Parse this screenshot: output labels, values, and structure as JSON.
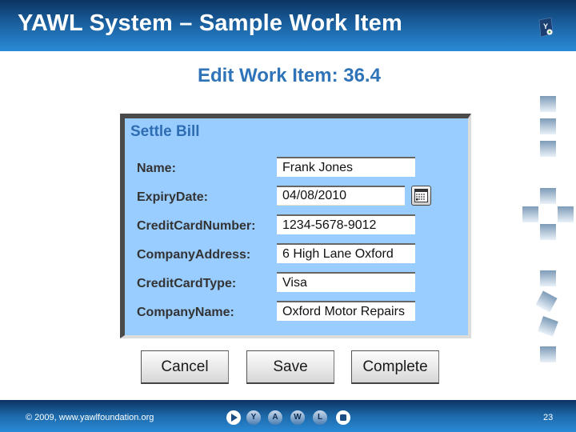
{
  "header": {
    "title": "YAWL System – Sample Work Item",
    "logo_icon": "yawl-logo-icon"
  },
  "work_item": {
    "title": "Edit Work Item: 36.4"
  },
  "form": {
    "title": "Settle Bill",
    "fields": [
      {
        "label": "Name:",
        "value": "Frank Jones"
      },
      {
        "label": "ExpiryDate:",
        "value": "04/08/2010"
      },
      {
        "label": "CreditCardNumber:",
        "value": "1234-5678-9012"
      },
      {
        "label": "CompanyAddress:",
        "value": "6 High Lane Oxford"
      },
      {
        "label": "CreditCardType:",
        "value": "Visa"
      },
      {
        "label": "CompanyName:",
        "value": "Oxford Motor Repairs"
      }
    ],
    "calendar_icon": "calendar-icon"
  },
  "buttons": {
    "cancel": "Cancel",
    "save": "Save",
    "complete": "Complete"
  },
  "footer": {
    "copyright": "© 2009, www.yawlfoundation.org",
    "page_number": "23",
    "nav_letters": [
      "Y",
      "A",
      "W",
      "L"
    ]
  },
  "colors": {
    "header_dark": "#0b3361",
    "header_light": "#2a8ad6",
    "title_blue": "#2f74b8",
    "panel_bg": "#99ccff"
  }
}
